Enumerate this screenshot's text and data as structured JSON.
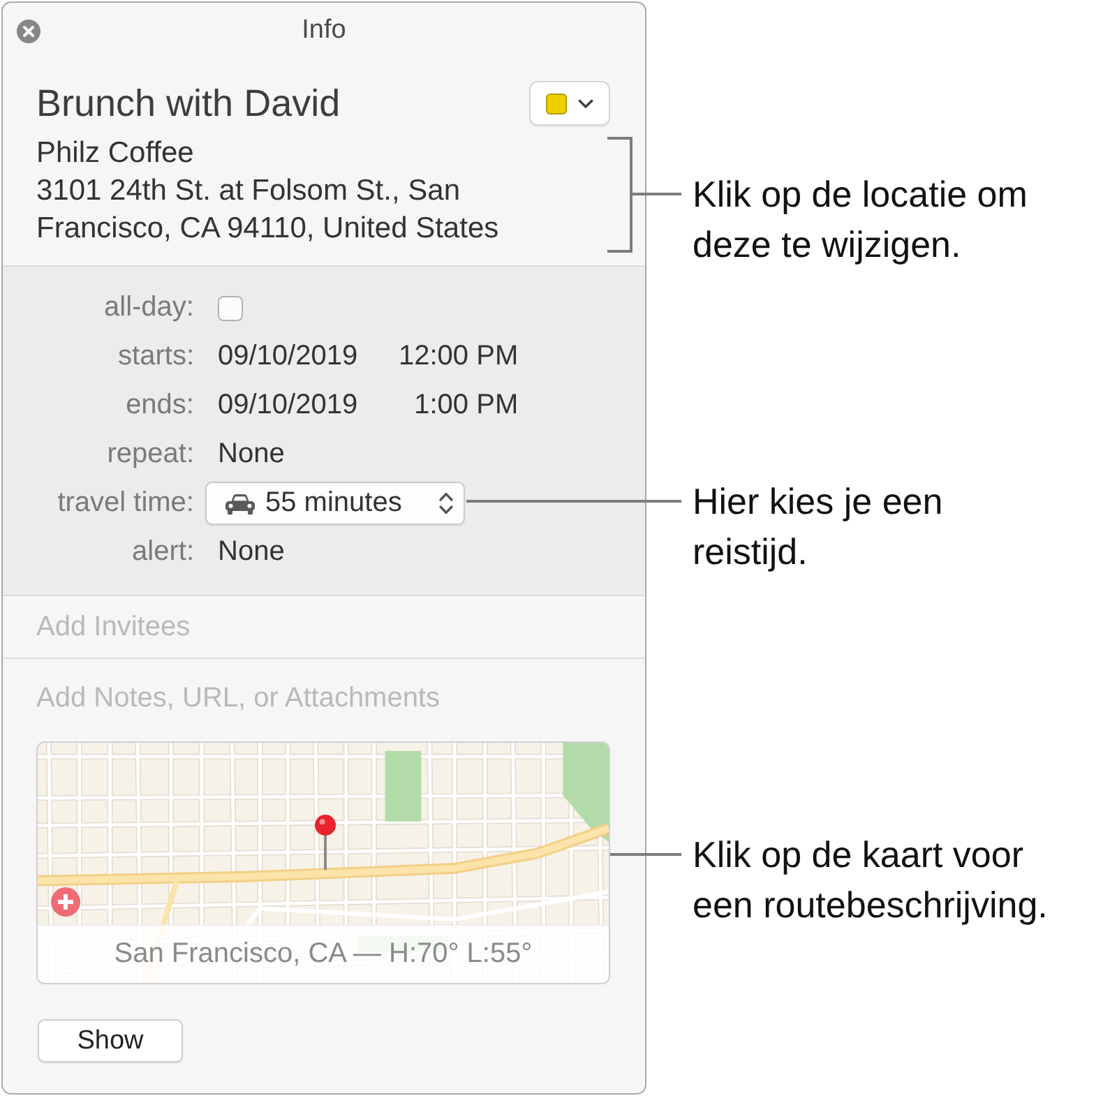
{
  "window": {
    "title": "Info"
  },
  "event": {
    "title": "Brunch with David",
    "calendar": {
      "color": "#eed000"
    },
    "location_lines": [
      "Philz Coffee",
      "3101 24th St. at Folsom St., San",
      "Francisco, CA 94110, United States"
    ]
  },
  "details": [
    {
      "kind": "checkbox",
      "label": "all-day:",
      "checked": false
    },
    {
      "kind": "datetime",
      "label": "starts:",
      "date": "09/10/2019",
      "time": "12:00 PM"
    },
    {
      "kind": "datetime",
      "label": "ends:",
      "date": "09/10/2019",
      "time": "1:00 PM"
    },
    {
      "kind": "text",
      "label": "repeat:",
      "value": "None"
    },
    {
      "kind": "popup",
      "label": "travel time:",
      "value": "55 minutes"
    },
    {
      "kind": "text",
      "label": "alert:",
      "value": "None"
    }
  ],
  "invitees": {
    "placeholder": "Add Invitees"
  },
  "notes": {
    "placeholder": "Add Notes, URL, or Attachments"
  },
  "map": {
    "caption": "San Francisco, CA — H:70° L:55°"
  },
  "show_button": "Show",
  "callouts": [
    {
      "kind": "bracket",
      "lines": [
        "Klik op de locatie om",
        "deze te wijzigen."
      ]
    },
    {
      "kind": "line",
      "lines": [
        "Hier kies je een",
        "reistijd."
      ]
    },
    {
      "kind": "line",
      "lines": [
        "Klik op de kaart voor",
        "een routebeschrijving."
      ]
    }
  ]
}
